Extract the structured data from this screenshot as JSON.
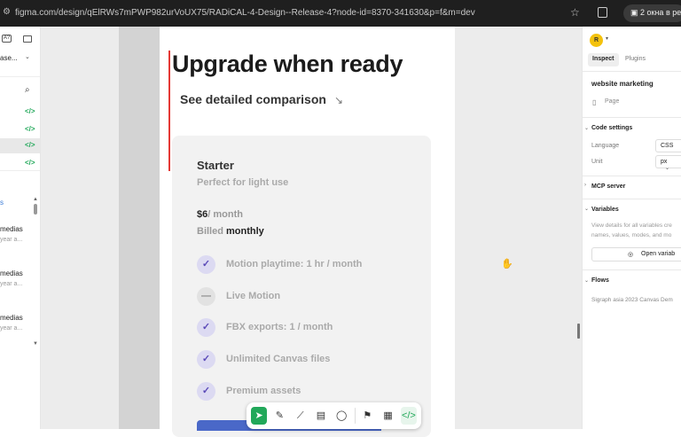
{
  "browser": {
    "url": "figma.com/design/qElRWs7mPWP982urVoUX75/RADiCAL-4-Design--Release-4?node-id=8370-341630&p=f&m=dev",
    "windows_label": "2 окна в реж"
  },
  "left_panel": {
    "file_name": "ase...",
    "layers": [
      {
        "label": "medias",
        "time": "year a..."
      },
      {
        "label": "medias",
        "time": "year a..."
      },
      {
        "label": "medias",
        "time": "year a..."
      }
    ],
    "section_letter": "s"
  },
  "design": {
    "title": "Upgrade when ready",
    "compare_link": "See detailed comparison",
    "compare_arrow": "↘",
    "plan": {
      "name": "Starter",
      "subtitle": "Perfect for light use",
      "price": "$6",
      "price_unit": "/ month",
      "billed_prefix": "Billed",
      "billed_period": "monthly"
    },
    "features": [
      {
        "label": "Motion playtime: 1 hr / month",
        "state": "check"
      },
      {
        "label": "Live Motion",
        "state": "dash"
      },
      {
        "label": "FBX exports: 1  / month",
        "state": "check"
      },
      {
        "label": "Unlimited Canvas files",
        "state": "check"
      },
      {
        "label": "Premium assets",
        "state": "check"
      }
    ]
  },
  "right_panel": {
    "avatar": "R",
    "tabs": [
      "Inspect",
      "Plugins"
    ],
    "page_name": "website marketing",
    "page_label": "Page",
    "code_settings": {
      "title": "Code settings",
      "language_label": "Language",
      "language_value": "CSS",
      "unit_label": "Unit",
      "unit_value": "px"
    },
    "mcp_title": "MCP server",
    "variables": {
      "title": "Variables",
      "description": "View details for all variables cre names, values, modes, and mo",
      "button": "Open variab"
    },
    "flows": {
      "title": "Flows",
      "item": "Sigraph asia 2023 Canvas Dem"
    }
  }
}
